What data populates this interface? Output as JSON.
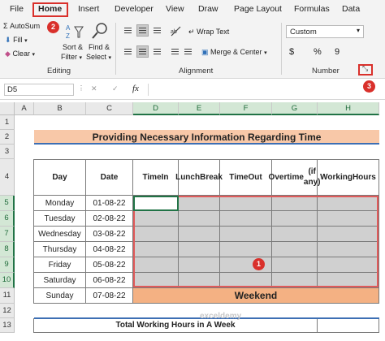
{
  "menu": {
    "file": "File",
    "home": "Home",
    "insert": "Insert",
    "developer": "Developer",
    "view": "View",
    "draw": "Draw",
    "page_layout": "Page Layout",
    "formulas": "Formulas",
    "data": "Data"
  },
  "badges": {
    "home_step": "2",
    "launcher_step": "3",
    "range_step": "1"
  },
  "ribbon": {
    "autosum": "AutoSum",
    "fill": "Fill",
    "clear": "Clear",
    "sort_filter_1": "Sort &",
    "sort_filter_2": "Filter",
    "find_select_1": "Find &",
    "find_select_2": "Select",
    "editing_label": "Editing",
    "wrap_text": "Wrap Text",
    "merge_center": "Merge & Center",
    "alignment_label": "Alignment",
    "number_format": "Custom",
    "number_label": "Number",
    "dollar": "$",
    "percent": "%",
    "comma": "9"
  },
  "formula_bar": {
    "name_box": "D5",
    "cancel": "✕",
    "enter": "✓",
    "fx": "fx"
  },
  "columns": [
    "A",
    "B",
    "C",
    "D",
    "E",
    "F",
    "G",
    "H"
  ],
  "rows": [
    "1",
    "2",
    "3",
    "4",
    "5",
    "6",
    "7",
    "8",
    "9",
    "10",
    "11",
    "12",
    "13"
  ],
  "sheet": {
    "title": "Providing Necessary Information Regarding Time",
    "headers": {
      "day": "Day",
      "date": "Date",
      "time_in_1": "Time",
      "time_in_2": "In",
      "lunch_1": "Lunch",
      "lunch_2": "Break",
      "time_out_1": "Time",
      "time_out_2": "Out",
      "overtime_1": "Overtime",
      "overtime_2": "(if any)",
      "working_1": "Working",
      "working_2": "Hours"
    },
    "days": [
      {
        "day": "Monday",
        "date": "01-08-22"
      },
      {
        "day": "Tuesday",
        "date": "02-08-22"
      },
      {
        "day": "Wednesday",
        "date": "03-08-22"
      },
      {
        "day": "Thursday",
        "date": "04-08-22"
      },
      {
        "day": "Friday",
        "date": "05-08-22"
      },
      {
        "day": "Saturday",
        "date": "06-08-22"
      },
      {
        "day": "Sunday",
        "date": "07-08-22"
      }
    ],
    "weekend": "Weekend",
    "total_label": "Total Working Hours in A Week"
  },
  "watermark": "exceldemy",
  "colors": {
    "accent_red": "#d9302b",
    "excel_green": "#217346",
    "title_fill": "#f8c8a8",
    "weekend_fill": "#f4b183"
  }
}
